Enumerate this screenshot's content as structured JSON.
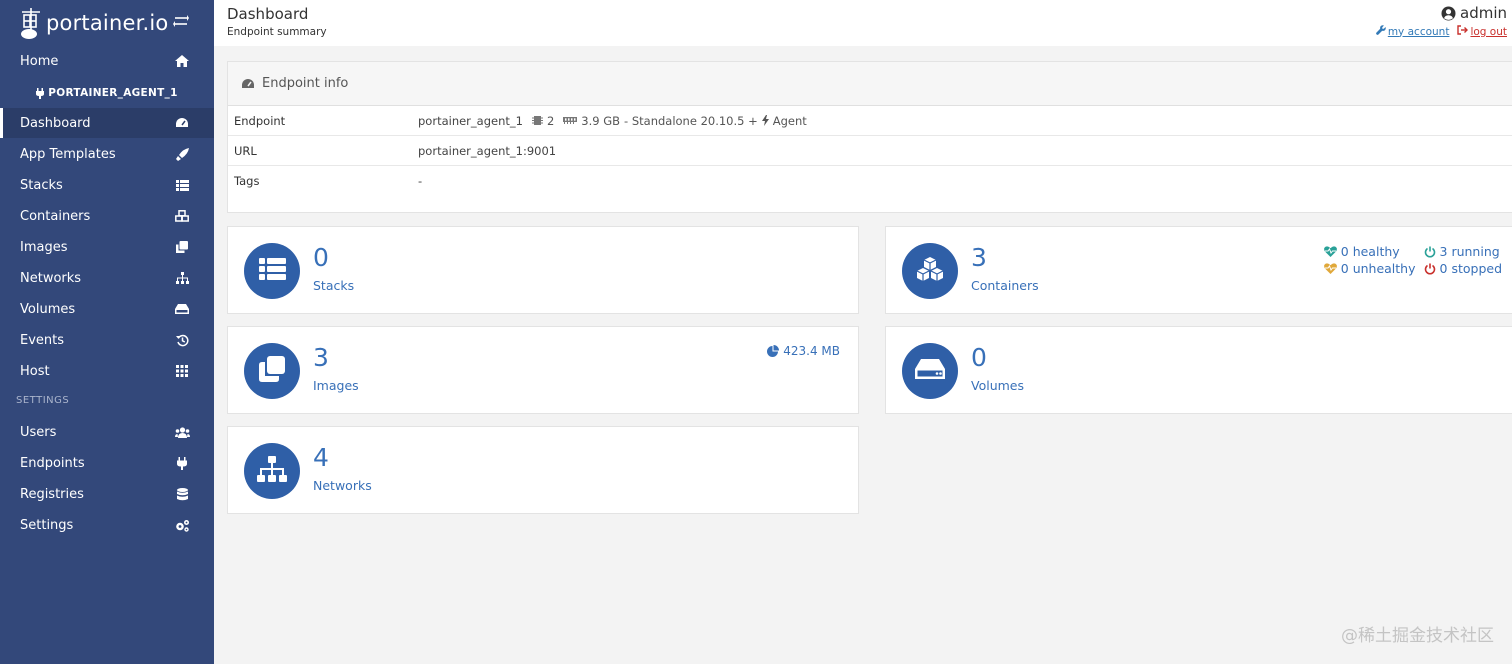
{
  "brand": {
    "name": "portainer.io"
  },
  "sidebar": {
    "endpoint": "PORTAINER_AGENT_1",
    "items": [
      {
        "label": "Home",
        "icon": "home-icon"
      },
      {
        "label": "Dashboard",
        "icon": "dashboard-icon",
        "active": true
      },
      {
        "label": "App Templates",
        "icon": "rocket-icon"
      },
      {
        "label": "Stacks",
        "icon": "list-icon"
      },
      {
        "label": "Containers",
        "icon": "cubes-icon"
      },
      {
        "label": "Images",
        "icon": "clone-icon"
      },
      {
        "label": "Networks",
        "icon": "sitemap-icon"
      },
      {
        "label": "Volumes",
        "icon": "hdd-icon"
      },
      {
        "label": "Events",
        "icon": "history-icon"
      },
      {
        "label": "Host",
        "icon": "grid-icon"
      }
    ],
    "settings_title": "SETTINGS",
    "settings_items": [
      {
        "label": "Users",
        "icon": "users-icon"
      },
      {
        "label": "Endpoints",
        "icon": "plug-icon"
      },
      {
        "label": "Registries",
        "icon": "database-icon"
      },
      {
        "label": "Settings",
        "icon": "cogs-icon"
      }
    ]
  },
  "header": {
    "title": "Dashboard",
    "subtitle": "Endpoint summary",
    "user": "admin",
    "my_account": "my account",
    "log_out": "log out"
  },
  "endpoint_info": {
    "title": "Endpoint info",
    "rows": [
      {
        "key": "Endpoint",
        "name": "portainer_agent_1",
        "cpu": "2",
        "memory": "3.9 GB",
        "details": "- Standalone 20.10.5 +",
        "agent": "Agent"
      },
      {
        "key": "URL",
        "value": "portainer_agent_1:9001"
      },
      {
        "key": "Tags",
        "value": "-"
      }
    ]
  },
  "tiles": {
    "stacks": {
      "count": "0",
      "label": "Stacks"
    },
    "containers": {
      "count": "3",
      "label": "Containers",
      "healthy": "0 healthy",
      "unhealthy": "0 unhealthy",
      "running": "3 running",
      "stopped": "0 stopped"
    },
    "images": {
      "count": "3",
      "label": "Images",
      "size": "423.4 MB"
    },
    "volumes": {
      "count": "0",
      "label": "Volumes"
    },
    "networks": {
      "count": "4",
      "label": "Networks"
    }
  },
  "colors": {
    "sidebar": "#33487a",
    "accent": "#3870b8",
    "icon_circle": "#2f5fa7",
    "healthy": "#2aa198",
    "unhealthy": "#e0a83a",
    "running": "#2aa198",
    "stopped": "#c9302c"
  },
  "watermark": "@稀土掘金技术社区"
}
